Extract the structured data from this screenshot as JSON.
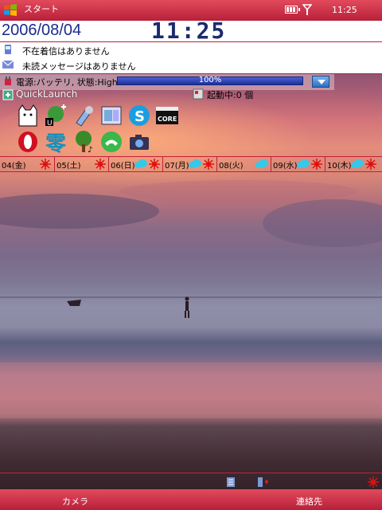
{
  "titlebar": {
    "title": "スタート",
    "clock": "11:25",
    "icons": [
      "windows-start-icon",
      "battery-icon",
      "signal-icon"
    ]
  },
  "today": {
    "date": "2006/08/04",
    "time": "11:25"
  },
  "notifications": {
    "missed_calls": "不在着信はありません",
    "unread_messages": "未読メッセージはありません"
  },
  "power": {
    "label": "電源:バッテリ, 状態:High",
    "percent_text": "100%",
    "level": 1.0
  },
  "quicklaunch": {
    "label": "QuickLaunch",
    "running": "起動中:0 個",
    "apps_row1": [
      "cat-app-icon",
      "update-app-icon",
      "phone-tools-icon",
      "file-explorer-icon",
      "skype-icon",
      "core-app-icon"
    ],
    "apps_row2": [
      "opera-icon",
      "kanji-zero-icon",
      "tree-music-icon",
      "green-phone-icon",
      "camera-icon"
    ]
  },
  "weather": [
    {
      "label": "04(金)",
      "icons": [
        "sun"
      ]
    },
    {
      "label": "05(土)",
      "icons": [
        "sun"
      ]
    },
    {
      "label": "06(日)",
      "icons": [
        "cloud",
        "sun"
      ]
    },
    {
      "label": "07(月)",
      "icons": [
        "cloud",
        "sun"
      ]
    },
    {
      "label": "08(火)",
      "icons": [
        "cloud"
      ]
    },
    {
      "label": "09(水)",
      "icons": [
        "cloud",
        "sun"
      ]
    },
    {
      "label": "10(木)",
      "icons": [
        "cloud",
        "sun"
      ]
    }
  ],
  "softkeys": {
    "left": "カメラ",
    "right": "連絡先"
  },
  "colors": {
    "accent": "#c0203a",
    "date_text": "#1a2a8c"
  }
}
